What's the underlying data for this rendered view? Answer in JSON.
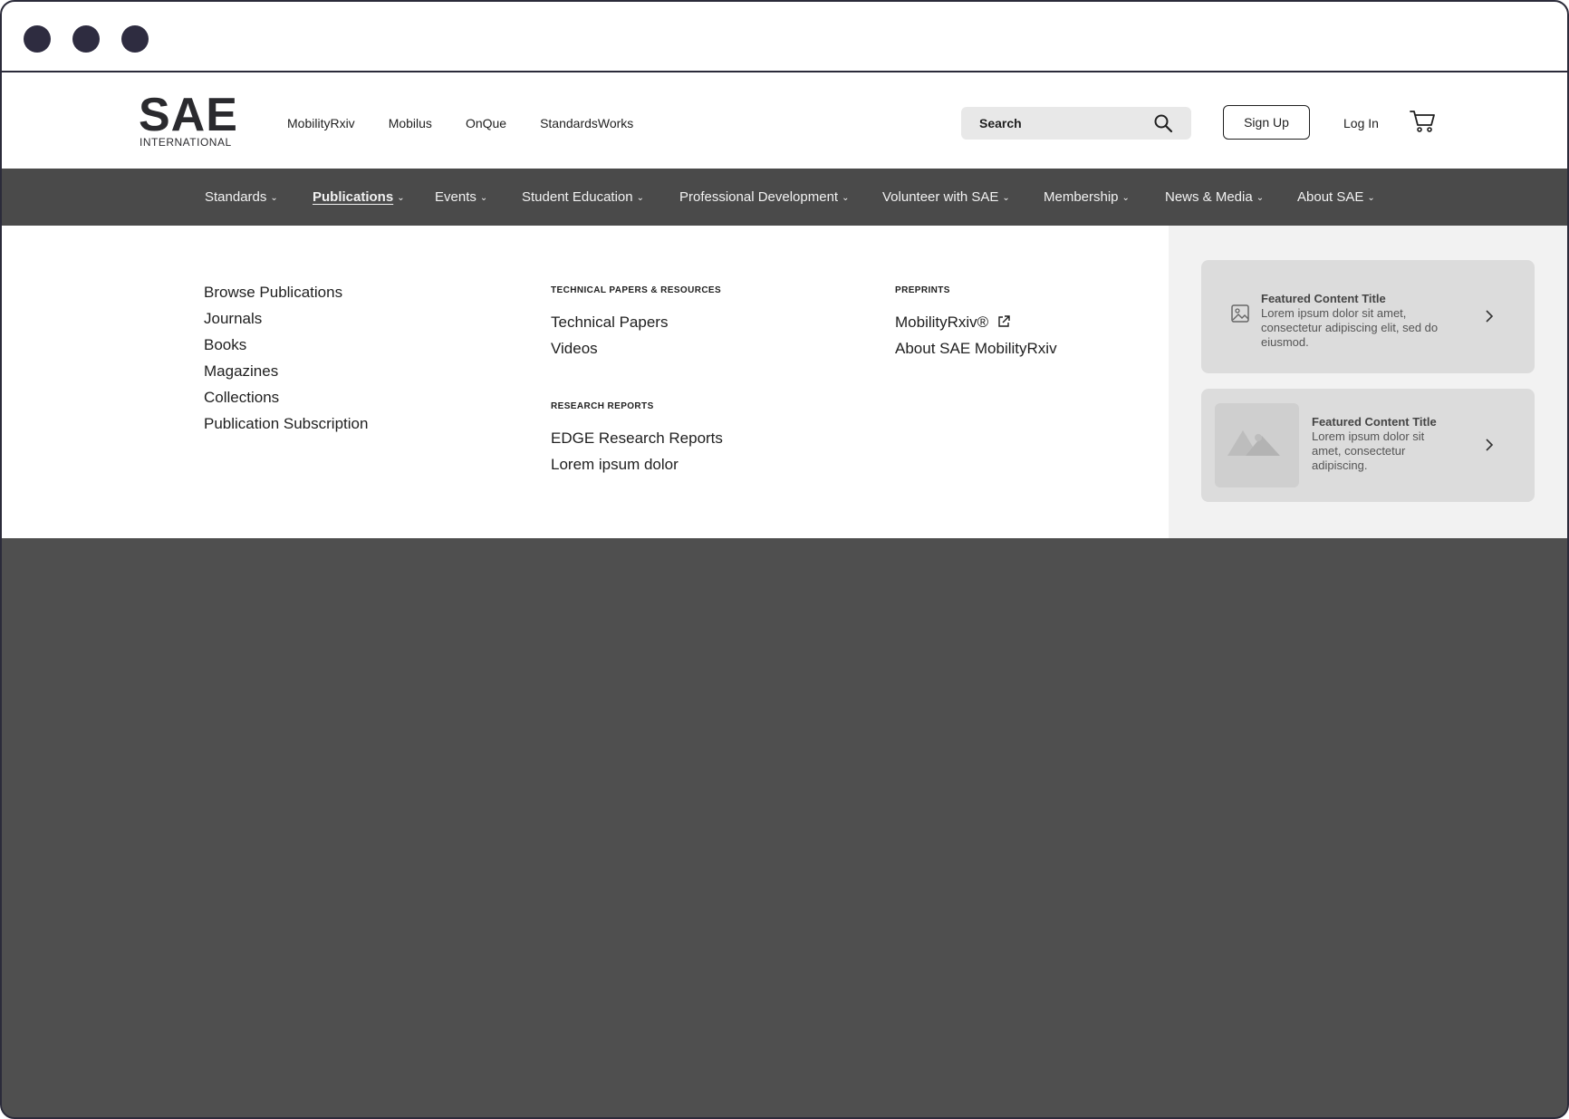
{
  "header": {
    "logo_main": "SAE",
    "logo_sub": "INTERNATIONAL",
    "top_links": [
      "MobilityRxiv",
      "Mobilus",
      "OnQue",
      "StandardsWorks"
    ],
    "search_label": "Search",
    "signup_label": "Sign Up",
    "login_label": "Log In"
  },
  "nav": {
    "items": [
      {
        "label": "Standards",
        "active": false
      },
      {
        "label": "Publications",
        "active": true
      },
      {
        "label": "Events",
        "active": false
      },
      {
        "label": "Student Education",
        "active": false
      },
      {
        "label": "Professional Development",
        "active": false
      },
      {
        "label": "Volunteer with SAE",
        "active": false
      },
      {
        "label": "Membership",
        "active": false
      },
      {
        "label": "News & Media",
        "active": false
      },
      {
        "label": "About SAE",
        "active": false
      }
    ],
    "chevron": "⌄"
  },
  "dropdown": {
    "col1": [
      "Browse Publications",
      "Journals",
      "Books",
      "Magazines",
      "Collections",
      "Publication Subscription"
    ],
    "col2_head1": "TECHNICAL PAPERS & RESOURCES",
    "col2_group1": [
      "Technical Papers",
      "Videos"
    ],
    "col2_head2": "RESEARCH REPORTS",
    "col2_group2": [
      "EDGE Research Reports",
      "Lorem ipsum dolor"
    ],
    "col3_head": "PREPRINTS",
    "col3_links": [
      "MobilityRxiv®",
      "About SAE MobilityRxiv"
    ]
  },
  "featured": [
    {
      "title": "Featured Content Title",
      "desc_lines": [
        "Lorem ipsum dolor sit amet,",
        "consectetur adipiscing elit, sed do",
        "eiusmod."
      ]
    },
    {
      "title": "Featured Content Title",
      "desc_lines": [
        "Lorem ipsum dolor sit",
        "amet, consectetur",
        "adipiscing."
      ]
    }
  ],
  "colors": {
    "nav_bg": "#4a4a4a",
    "overlay": "#4f4f4f",
    "featured_panel": "#f2f2f2",
    "card_bg": "#dcdcdc"
  }
}
